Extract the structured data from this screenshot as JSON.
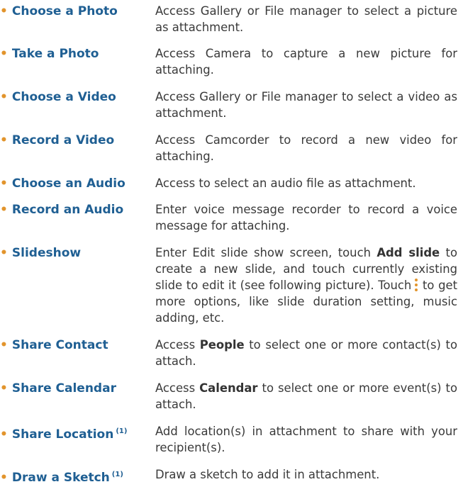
{
  "colors": {
    "term": "#1f5f93",
    "bullet": "#e2942c",
    "text": "#3a3a3a"
  },
  "bullet_glyph": "•",
  "items": [
    {
      "term": "Choose a Photo",
      "desc": "Access Gallery or File manager to select a picture as attachment."
    },
    {
      "term": "Take a Photo",
      "desc": "Access Camera to capture a new picture for attaching."
    },
    {
      "term": "Choose a Video",
      "desc": "Access Gallery or File manager to select a video as attachment."
    },
    {
      "term": "Record a Video",
      "desc": "Access Camcorder to record a new video for attaching."
    },
    {
      "term": "Choose an Audio",
      "desc": "Access to select an audio file as attachment."
    },
    {
      "term": "Record an Audio",
      "desc": "Enter voice message recorder to record a voice message for attaching."
    },
    {
      "term": "Slideshow",
      "desc_part1": "Enter Edit slide show screen, touch ",
      "desc_bold1": "Add slide",
      "desc_part2": " to create a new slide, and touch currently existing slide to edit it (see following picture). Touch",
      "desc_icon": "more-vertical-icon",
      "desc_part3": " to get more options, like slide duration setting, music adding, etc."
    },
    {
      "term": "Share Contact",
      "desc_part1": "Access ",
      "desc_bold1": "People",
      "desc_part2": " to select one or more contact(s) to attach."
    },
    {
      "term": "Share Calendar",
      "desc_part1": "Access ",
      "desc_bold1": "Calendar",
      "desc_part2": " to select one or more event(s) to attach."
    },
    {
      "term": "Share Location",
      "footnote": "(1)",
      "desc": "Add location(s) in attachment to share with your recipient(s)."
    },
    {
      "term": "Draw a Sketch",
      "footnote": "(1)",
      "desc": "Draw a sketch to add it in attachment."
    }
  ]
}
